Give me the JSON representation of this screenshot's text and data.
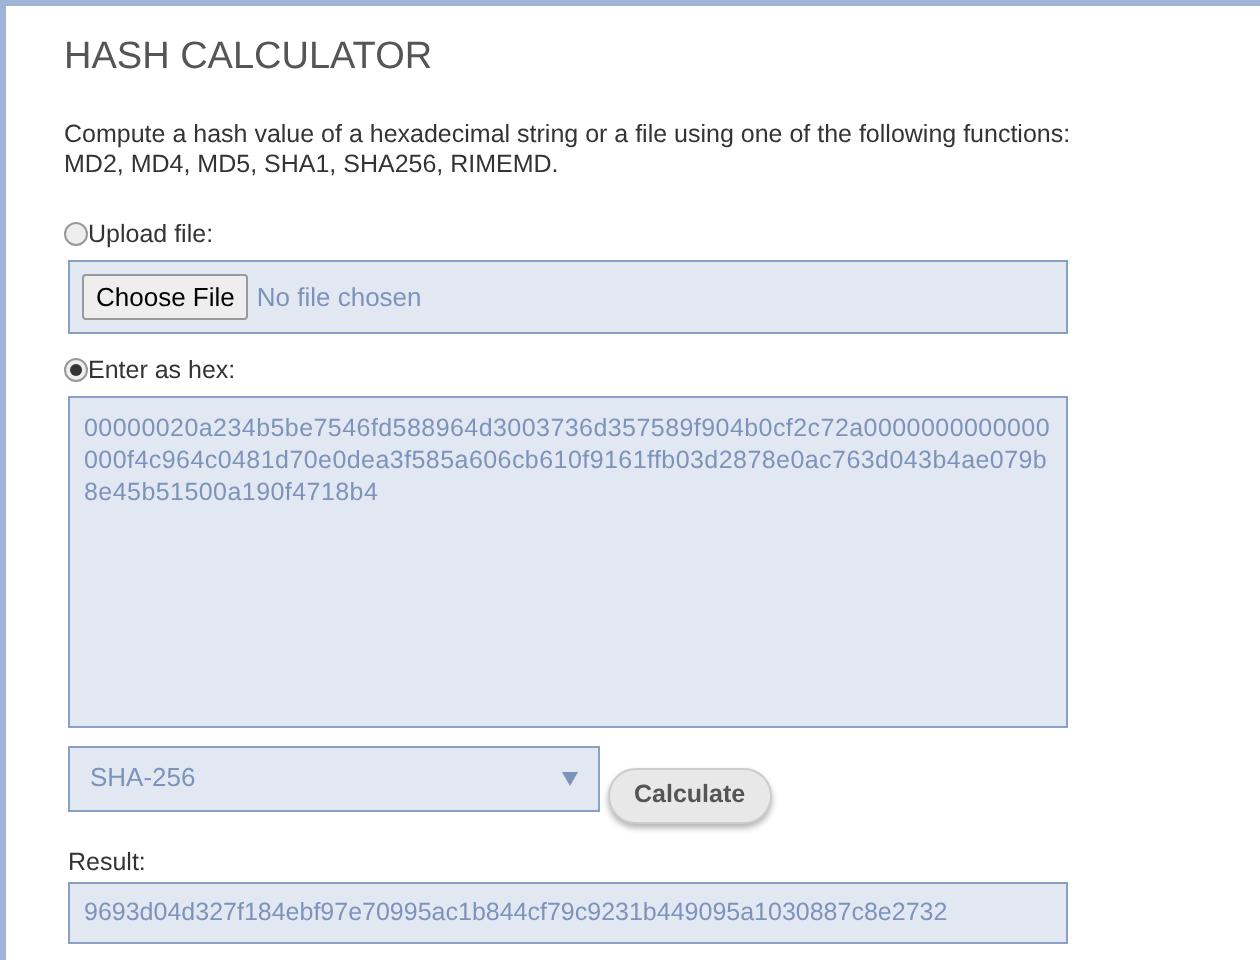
{
  "title": "HASH CALCULATOR",
  "description": "Compute a hash value of a hexadecimal string or a file using one of the following functions: MD2, MD4, MD5, SHA1, SHA256, RIMEMD.",
  "sources": [
    {
      "label": "Upload file:",
      "selected": false,
      "kind": "file",
      "button": "Choose File",
      "status": "No file chosen"
    },
    {
      "label": "Enter as hex:",
      "selected": true,
      "kind": "hex",
      "value": "00000020a234b5be7546fd588964d3003736d357589f904b0cf2c72a0000000000000000f4c964c0481d70e0dea3f585a606cb610f9161ffb03d2878e0ac763d043b4ae079b8e45b51500a190f4718b4"
    }
  ],
  "algorithm": "SHA-256",
  "calculate_button": "Calculate",
  "result": {
    "label": "Result:",
    "value": "9693d04d327f184ebf97e70995ac1b844cf79c9231b449095a1030887c8e2732"
  }
}
